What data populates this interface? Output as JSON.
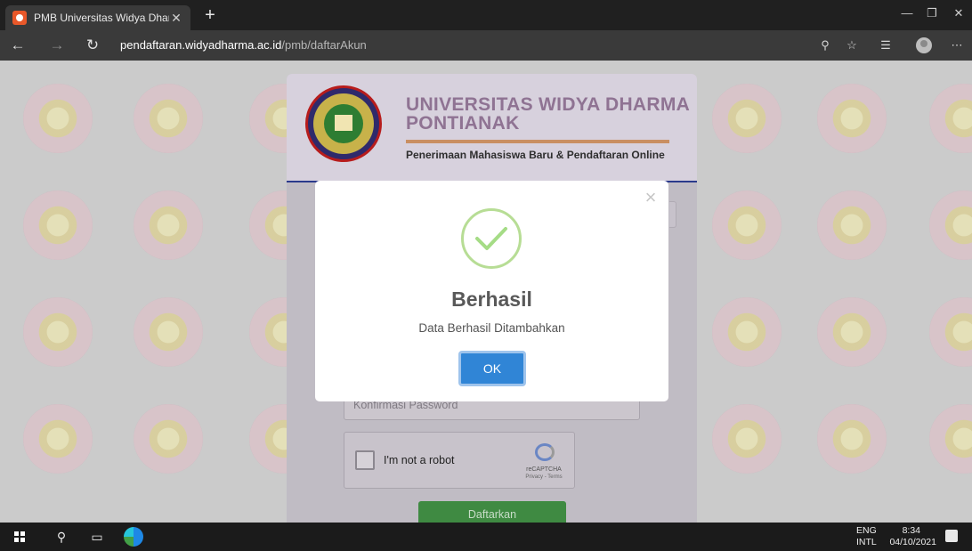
{
  "browser": {
    "tab_title": "PMB Universitas Widya Dharma",
    "url_host": "pendaftaran.widyadharma.ac.id",
    "url_path": "/pmb/daftarAkun"
  },
  "page": {
    "university_name_line1": "UNIVERSITAS WIDYA DHARMA",
    "university_name_line2": "PONTIANAK",
    "subtitle": "Penerimaan Mahasiswa Baru & Pendaftaran Online",
    "confirm_password_placeholder": "Konfirmasi Password",
    "captcha_label": "I'm not a robot",
    "captcha_brand": "reCAPTCHA",
    "captcha_links": "Privacy - Terms",
    "submit_label": "Daftarkan"
  },
  "modal": {
    "title": "Berhasil",
    "message": "Data Berhasil Ditambahkan",
    "ok_label": "OK",
    "close_glyph": "×",
    "accent_color": "#3085d6",
    "success_color": "#a5dc86"
  },
  "taskbar": {
    "lang_line1": "ENG",
    "lang_line2": "INTL",
    "time": "8:34",
    "date": "04/10/2021"
  }
}
